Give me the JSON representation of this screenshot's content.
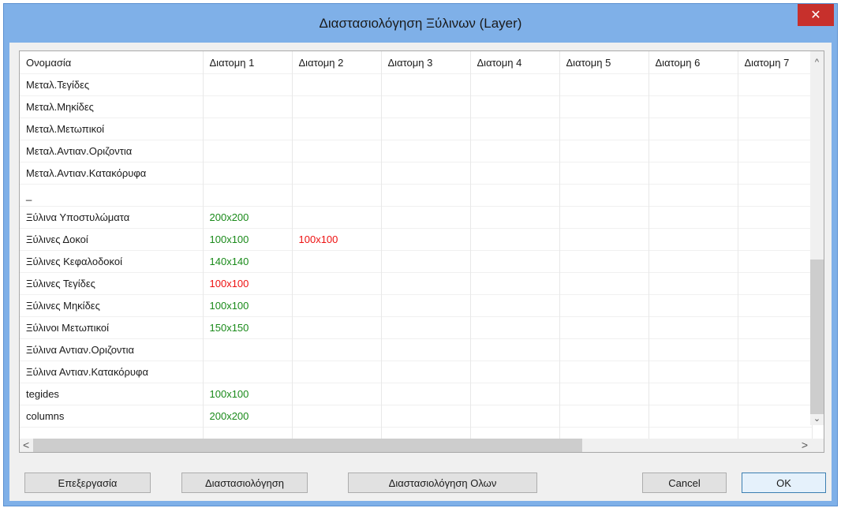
{
  "window": {
    "title": "Διαστασιολόγηση Ξύλινων (Layer)",
    "close_glyph": "✕"
  },
  "grid": {
    "columns": [
      "Ονομασία",
      "Διατομη 1",
      "Διατομη 2",
      "Διατομη 3",
      "Διατομη 4",
      "Διατομη 5",
      "Διατομη 6",
      "Διατομη 7"
    ],
    "rows": [
      {
        "name": "Μεταλ.Τεγίδες",
        "d1": "",
        "d1_color": "",
        "d2": "",
        "d2_color": ""
      },
      {
        "name": "Μεταλ.Μηκίδες",
        "d1": "",
        "d1_color": "",
        "d2": "",
        "d2_color": ""
      },
      {
        "name": "Μεταλ.Μετωπικοί",
        "d1": "",
        "d1_color": "",
        "d2": "",
        "d2_color": ""
      },
      {
        "name": "Μεταλ.Αντιαν.Οριζοντια",
        "d1": "",
        "d1_color": "",
        "d2": "",
        "d2_color": ""
      },
      {
        "name": "Μεταλ.Αντιαν.Κατακόρυφα",
        "d1": "",
        "d1_color": "",
        "d2": "",
        "d2_color": ""
      },
      {
        "name": "_",
        "d1": "",
        "d1_color": "",
        "d2": "",
        "d2_color": ""
      },
      {
        "name": "Ξύλινα Υποστυλώματα",
        "d1": "200x200",
        "d1_color": "green",
        "d2": "",
        "d2_color": ""
      },
      {
        "name": "Ξύλινες Δοκοί",
        "d1": "100x100",
        "d1_color": "green",
        "d2": "100x100",
        "d2_color": "red"
      },
      {
        "name": "Ξύλινες Κεφαλοδοκοί",
        "d1": "140x140",
        "d1_color": "green",
        "d2": "",
        "d2_color": ""
      },
      {
        "name": "Ξύλινες Τεγίδες",
        "d1": "100x100",
        "d1_color": "red",
        "d2": "",
        "d2_color": ""
      },
      {
        "name": "Ξύλινες Μηκίδες",
        "d1": "100x100",
        "d1_color": "green",
        "d2": "",
        "d2_color": ""
      },
      {
        "name": "Ξύλινοι Μετωπικοί",
        "d1": "150x150",
        "d1_color": "green",
        "d2": "",
        "d2_color": ""
      },
      {
        "name": "Ξύλινα Αντιαν.Οριζοντια",
        "d1": "",
        "d1_color": "",
        "d2": "",
        "d2_color": ""
      },
      {
        "name": "Ξύλινα Αντιαν.Κατακόρυφα",
        "d1": "",
        "d1_color": "",
        "d2": "",
        "d2_color": ""
      },
      {
        "name": "tegides",
        "d1": "100x100",
        "d1_color": "green",
        "d2": "",
        "d2_color": ""
      },
      {
        "name": "columns",
        "d1": "200x200",
        "d1_color": "green",
        "d2": "",
        "d2_color": ""
      },
      {
        "name": "",
        "d1": "",
        "d1_color": "",
        "d2": "",
        "d2_color": ""
      }
    ]
  },
  "scrollbars": {
    "up": "^",
    "down": "⌄",
    "left": "<",
    "right": ">"
  },
  "buttons": {
    "edit": "Επεξεργασία",
    "dimension": "Διαστασιολόγηση",
    "dimension_all": "Διαστασιολόγηση Ολων",
    "cancel": "Cancel",
    "ok": "OK"
  },
  "colors": {
    "green": "#1a8a1a",
    "red": "#ee1111",
    "window_frame": "#7fb0e8",
    "close_button": "#c7302c"
  }
}
